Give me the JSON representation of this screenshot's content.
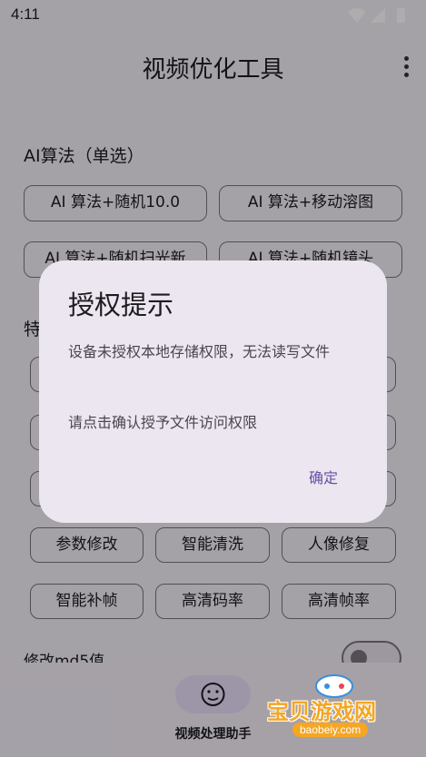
{
  "status_bar": {
    "time": "4:11"
  },
  "app_bar": {
    "title": "视频优化工具"
  },
  "algorithm_section": {
    "label": "AI算法（单选）",
    "options": [
      "AI 算法+随机10.0",
      "AI 算法+移动溶图",
      "AI 算法+随机扫光新",
      "AI 算法+随机镜头"
    ]
  },
  "features_section": {
    "label": "特",
    "row_a": [
      "参数修改",
      "智能清洗",
      "人像修复"
    ],
    "row_b": [
      "智能补帧",
      "高清码率",
      "高清帧率"
    ]
  },
  "md5_toggle": {
    "label": "修改md5值",
    "state": "off"
  },
  "bottom_nav": {
    "label": "视频处理助手"
  },
  "dialog": {
    "title": "授权提示",
    "message_1": "设备未授权本地存储权限，无法读写文件",
    "message_2": "请点击确认授予文件访问权限",
    "confirm": "确定"
  },
  "watermark": {
    "text": "宝贝游戏网",
    "url": "baobeiy.com"
  },
  "colors": {
    "accent": "#6750a4",
    "dialog_bg": "#ece6f0",
    "outline": "#79747e"
  }
}
